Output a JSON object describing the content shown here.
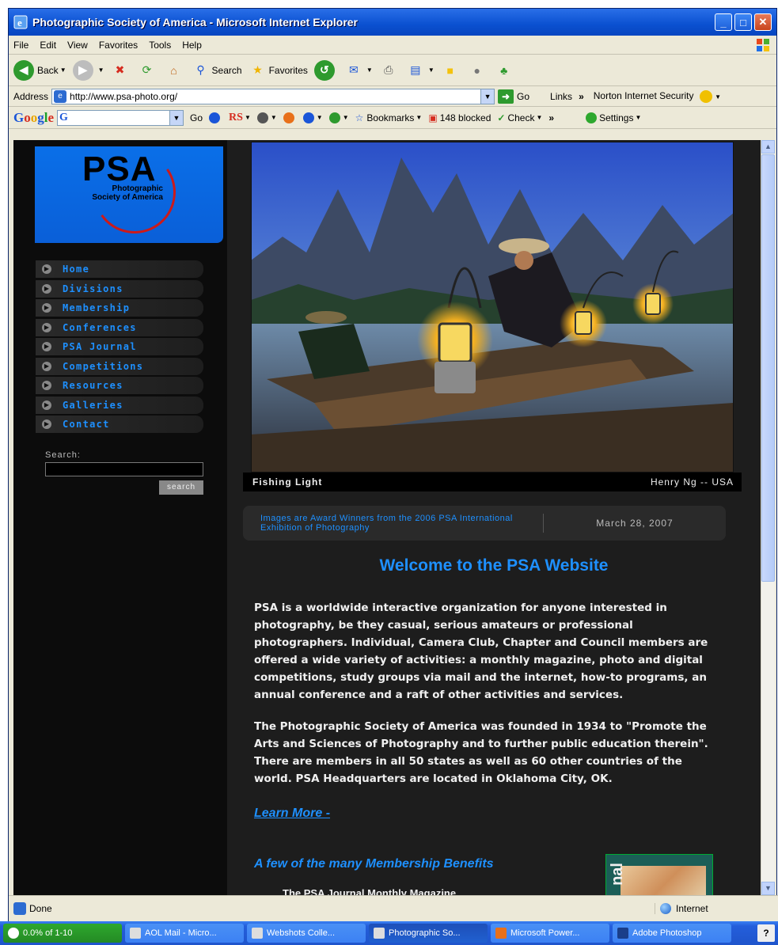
{
  "window": {
    "title": "Photographic Society of America - Microsoft Internet Explorer",
    "minimize": "_",
    "maximize": "□",
    "close": "✕"
  },
  "menubar": {
    "items": [
      "File",
      "Edit",
      "View",
      "Favorites",
      "Tools",
      "Help"
    ]
  },
  "toolbar": {
    "back_label": "Back",
    "search_label": "Search",
    "favorites_label": "Favorites"
  },
  "addressbar": {
    "label": "Address",
    "url": "http://www.psa-photo.org/",
    "go_label": "Go",
    "links_label": "Links",
    "links_chevron": "»",
    "norton_label": "Norton Internet Security"
  },
  "googlebar": {
    "logo": [
      "G",
      "o",
      "o",
      "g",
      "l",
      "e"
    ],
    "box_glyph": "G",
    "go_label": "Go",
    "rs_label": "RS",
    "bookmarks_label": "Bookmarks",
    "blocked_label": "148 blocked",
    "check_label": "Check",
    "chevron": "»",
    "settings_label": "Settings"
  },
  "sidebar": {
    "logo_text": "PSA",
    "logo_sub": "Photographic Society of America",
    "nav": [
      "Home",
      "Divisions",
      "Membership",
      "Conferences",
      "PSA Journal",
      "Competitions",
      "Resources",
      "Galleries",
      "Contact"
    ],
    "search_label": "Search:",
    "search_button": "search"
  },
  "feature": {
    "title": "Fishing Light",
    "credit": "Henry Ng  --  USA",
    "award_text": "Images are Award Winners from the 2006 PSA International Exhibition of Photography",
    "date": "March 28, 2007"
  },
  "content": {
    "welcome": "Welcome to the PSA Website",
    "para1": "PSA is a worldwide interactive organization for anyone interested in photography, be they casual, serious amateurs or professional photographers.  Individual, Camera Club, Chapter and Council members are offered a wide variety of activities: a monthly magazine, photo and digital competitions, study groups via mail and the internet, how-to programs, an annual conference and a raft of other activities and services.",
    "para2": "The Photographic Society of America was founded in 1934 to \"Promote the Arts and Sciences of Photography and to further public education therein\".  There are members in all 50 states as well as 60 other countries of the world.  PSA Headquarters are located in Oklahoma City, OK.",
    "learn_more": "Learn More -",
    "benefits_heading": "A few of the many Membership Benefits",
    "journal_line": "The PSA Journal Monthly Magazine",
    "journal_thumb_text": "nal"
  },
  "statusbar": {
    "status": "Done",
    "zone": "Internet"
  },
  "taskbar": {
    "items": [
      "0.0% of 1-10",
      "AOL Mail - Micro...",
      "Webshots Colle...",
      "Photographic So...",
      "Microsoft Power...",
      "Adobe Photoshop"
    ],
    "help": "?"
  },
  "colors": {
    "link_blue": "#1e90ff",
    "page_bg": "#1d1d1d",
    "xp_title_blue": "#0a50d0"
  }
}
